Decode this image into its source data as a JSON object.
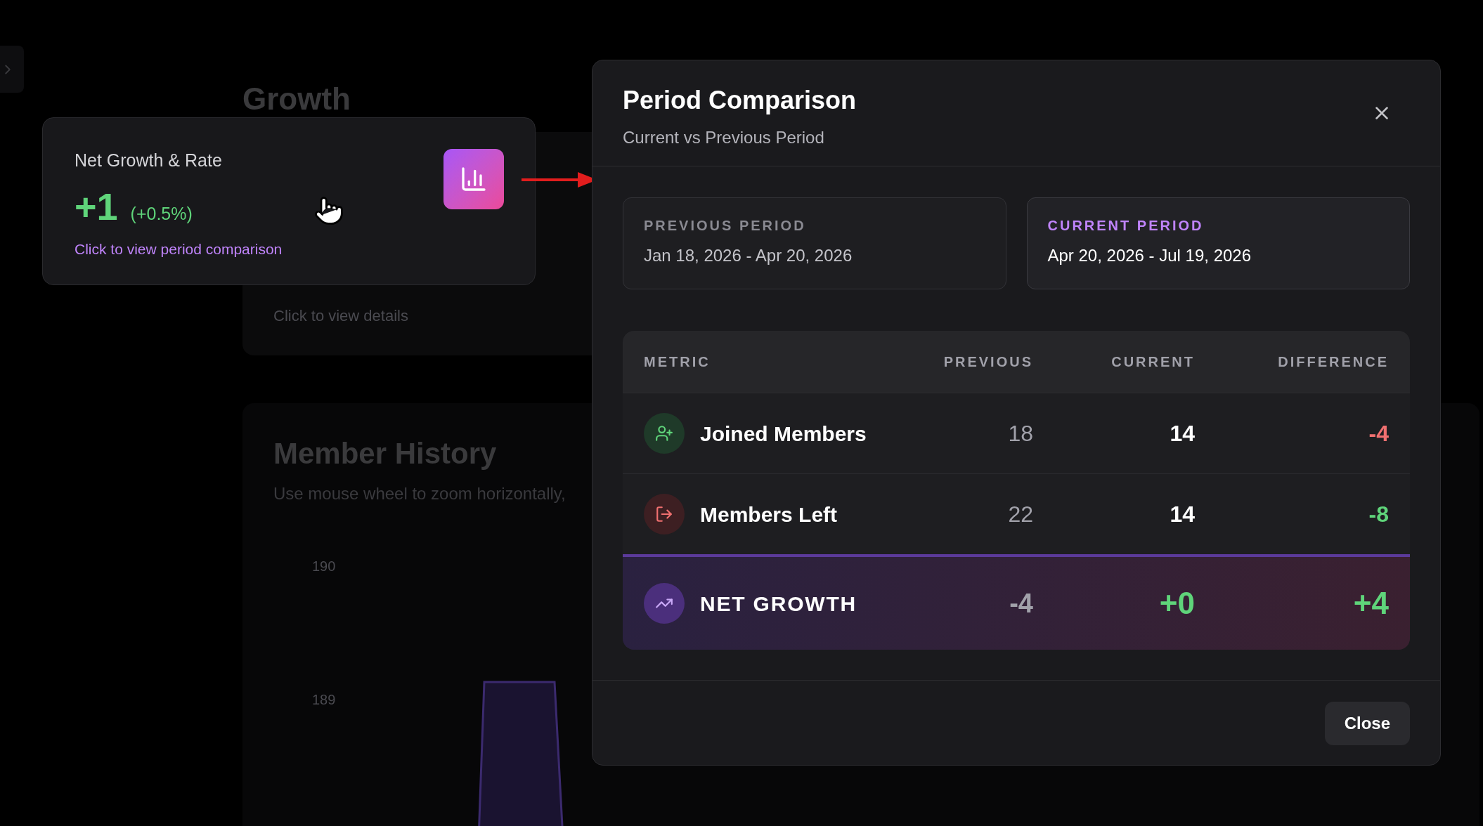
{
  "background": {
    "heading": "Growth",
    "card_hint": "Click to view details",
    "history": {
      "title": "Member History",
      "subtitle": "Use mouse wheel to zoom horizontally,",
      "y_ticks": [
        "190",
        "189"
      ]
    }
  },
  "highlight_card": {
    "title": "Net Growth & Rate",
    "value": "+1",
    "rate": "(+0.5%)",
    "link": "Click to view period comparison"
  },
  "dialog": {
    "title": "Period Comparison",
    "subtitle": "Current vs Previous Period",
    "periods": [
      {
        "label": "PREVIOUS PERIOD",
        "range": "Jan 18, 2026 - Apr 20, 2026",
        "current": false
      },
      {
        "label": "CURRENT PERIOD",
        "range": "Apr 20, 2026 - Jul 19, 2026",
        "current": true
      }
    ],
    "table": {
      "columns": [
        "METRIC",
        "PREVIOUS",
        "CURRENT",
        "DIFFERENCE"
      ],
      "rows": [
        {
          "kind": "joined",
          "metric": "Joined Members",
          "previous": "18",
          "current": "14",
          "difference": "-4",
          "color": "#f07070"
        },
        {
          "kind": "left",
          "metric": "Members Left",
          "previous": "22",
          "current": "14",
          "difference": "-8",
          "color": "#5fd47a"
        },
        {
          "kind": "net",
          "metric": "NET GROWTH",
          "previous": "-4",
          "current": "+0",
          "difference": "+4",
          "color": "#5fd47a"
        }
      ]
    },
    "close_label": "Close"
  }
}
